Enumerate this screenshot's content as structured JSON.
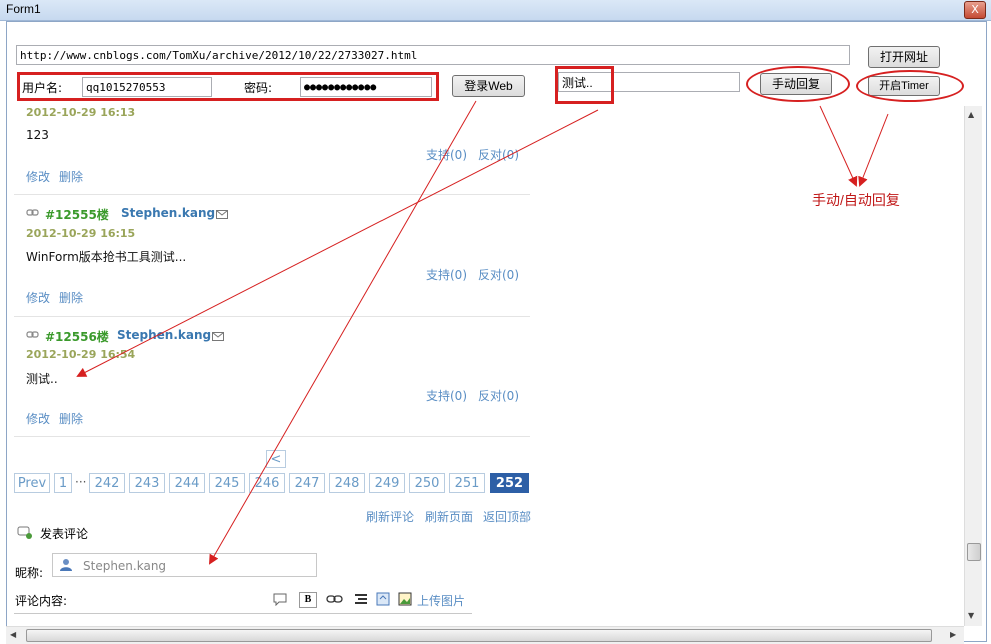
{
  "window": {
    "title": "Form1",
    "close_glyph": "X"
  },
  "toolbar": {
    "url_value": "http://www.cnblogs.com/TomXu/archive/2012/10/22/2733027.html",
    "open_url_label": "打开网址",
    "username_label": "用户名:",
    "username_value": "qq1015270553",
    "password_label": "密码:",
    "password_value": "●●●●●●●●●●●●",
    "login_label": "登录Web",
    "reply_value": "测试..",
    "manual_reply_label": "手动回复",
    "start_timer_label": "开启Timer"
  },
  "annotation": {
    "text": "手动/自动回复",
    "color": "#c01818"
  },
  "comments": [
    {
      "date": "2012-10-29 16:13",
      "body": "123",
      "support": "支持(0)",
      "oppose": "反对(0)",
      "edit": "修改",
      "delete": "删除"
    },
    {
      "floor": "#12555楼",
      "author": "Stephen.kang",
      "date": "2012-10-29 16:15",
      "body": "WinForm版本抢书工具测试...",
      "support": "支持(0)",
      "oppose": "反对(0)",
      "edit": "修改",
      "delete": "删除"
    },
    {
      "floor": "#12556楼",
      "author": "Stephen.kang",
      "date": "2012-10-29 16:54",
      "body": "测试..",
      "support": "支持(0)",
      "oppose": "反对(0)",
      "edit": "修改",
      "delete": "删除"
    }
  ],
  "pager": {
    "back": "<",
    "prev": "Prev",
    "first": "1",
    "ellipsis": "···",
    "pages": [
      "242",
      "243",
      "244",
      "245",
      "246",
      "247",
      "248",
      "249",
      "250",
      "251"
    ],
    "current": "252"
  },
  "actions": {
    "refresh_comments": "刷新评论",
    "refresh_page": "刷新页面",
    "back_to_top": "返回顶部"
  },
  "post": {
    "heading": "发表评论",
    "nickname_label": "昵称:",
    "nickname_value": "Stephen.kang",
    "content_label": "评论内容:",
    "upload_label": "上传图片",
    "bold_glyph": "B"
  },
  "colors": {
    "red_annotation": "#d62020",
    "link": "#5a8ec4",
    "date": "#9aa55a",
    "floor": "#3b9a2c",
    "pager_active": "#2d5fa6"
  }
}
